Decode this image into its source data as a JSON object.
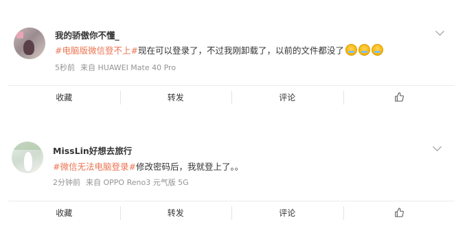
{
  "posts": [
    {
      "username": "我的骄傲你不懂_",
      "hashtag": "#电脑版微信登不上#",
      "text": "现在可以登录了，不过我刚卸载了，以前的文件都没了",
      "emoji_count": 3,
      "time": "5秒前",
      "source": "来自 HUAWEI Mate 40 Pro",
      "actions": {
        "collect": "收藏",
        "repost": "转发",
        "comment": "评论"
      }
    },
    {
      "username": "MissLin好想去旅行",
      "hashtag": "#微信无法电脑登录#",
      "text": "修改密码后，我就登上了。。",
      "emoji_count": 0,
      "time": "2分钟前",
      "source": "来自 OPPO Reno3 元气版 5G",
      "actions": {
        "collect": "收藏",
        "repost": "转发",
        "comment": "评论"
      }
    }
  ],
  "icons": {
    "more": "chevron-down-icon",
    "like": "thumbs-up-icon",
    "emoji": "laugh-cry-emoji"
  },
  "colors": {
    "hashtag": "#eb7350",
    "meta": "#939393",
    "text": "#333333"
  }
}
